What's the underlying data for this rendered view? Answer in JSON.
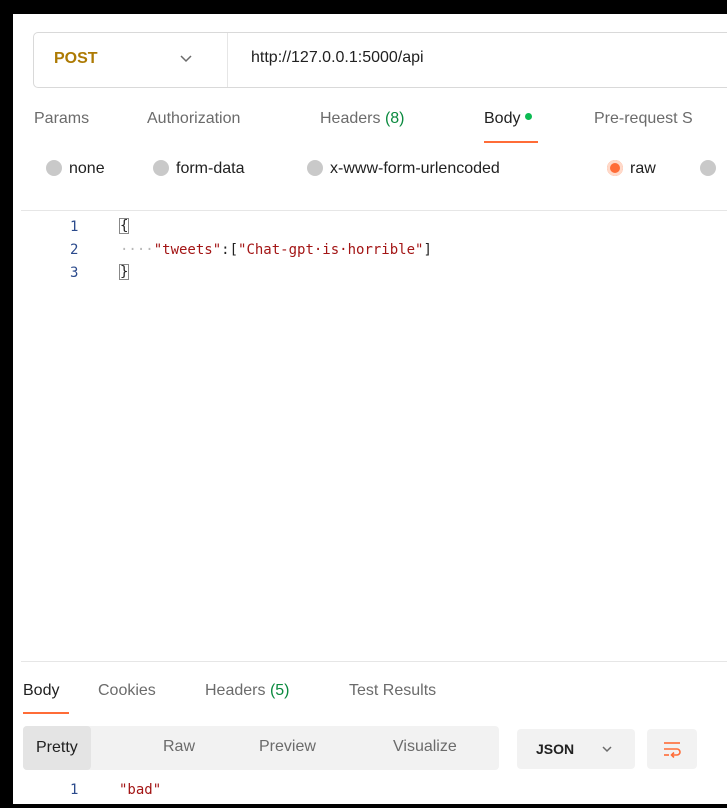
{
  "request": {
    "method": "POST",
    "url": "http://127.0.0.1:5000/api"
  },
  "request_tabs": [
    {
      "label": "Params"
    },
    {
      "label": "Authorization"
    },
    {
      "label": "Headers",
      "count": "(8)"
    },
    {
      "label": "Body"
    },
    {
      "label": "Pre-request S"
    }
  ],
  "body_types": [
    {
      "label": "none"
    },
    {
      "label": "form-data"
    },
    {
      "label": "x-www-form-urlencoded"
    },
    {
      "label": "raw"
    }
  ],
  "editor": {
    "line_numbers": [
      "1",
      "2",
      "3"
    ],
    "open_brace": "{",
    "close_brace": "}",
    "indent": "····",
    "key": "\"tweets\"",
    "colon_bracket": ":[",
    "value": "\"Chat-gpt·is·horrible\"",
    "close_bracket": "]"
  },
  "response_tabs": [
    {
      "label": "Body"
    },
    {
      "label": "Cookies"
    },
    {
      "label": "Headers",
      "count": "(5)"
    },
    {
      "label": "Test Results"
    }
  ],
  "view_modes": [
    "Pretty",
    "Raw",
    "Preview",
    "Visualize"
  ],
  "format": "JSON",
  "response": {
    "line_number": "1",
    "value": "\"bad\""
  },
  "colors": {
    "accent": "#ff6c37",
    "method": "#ad7a03",
    "active_dot": "#0cbb52"
  }
}
